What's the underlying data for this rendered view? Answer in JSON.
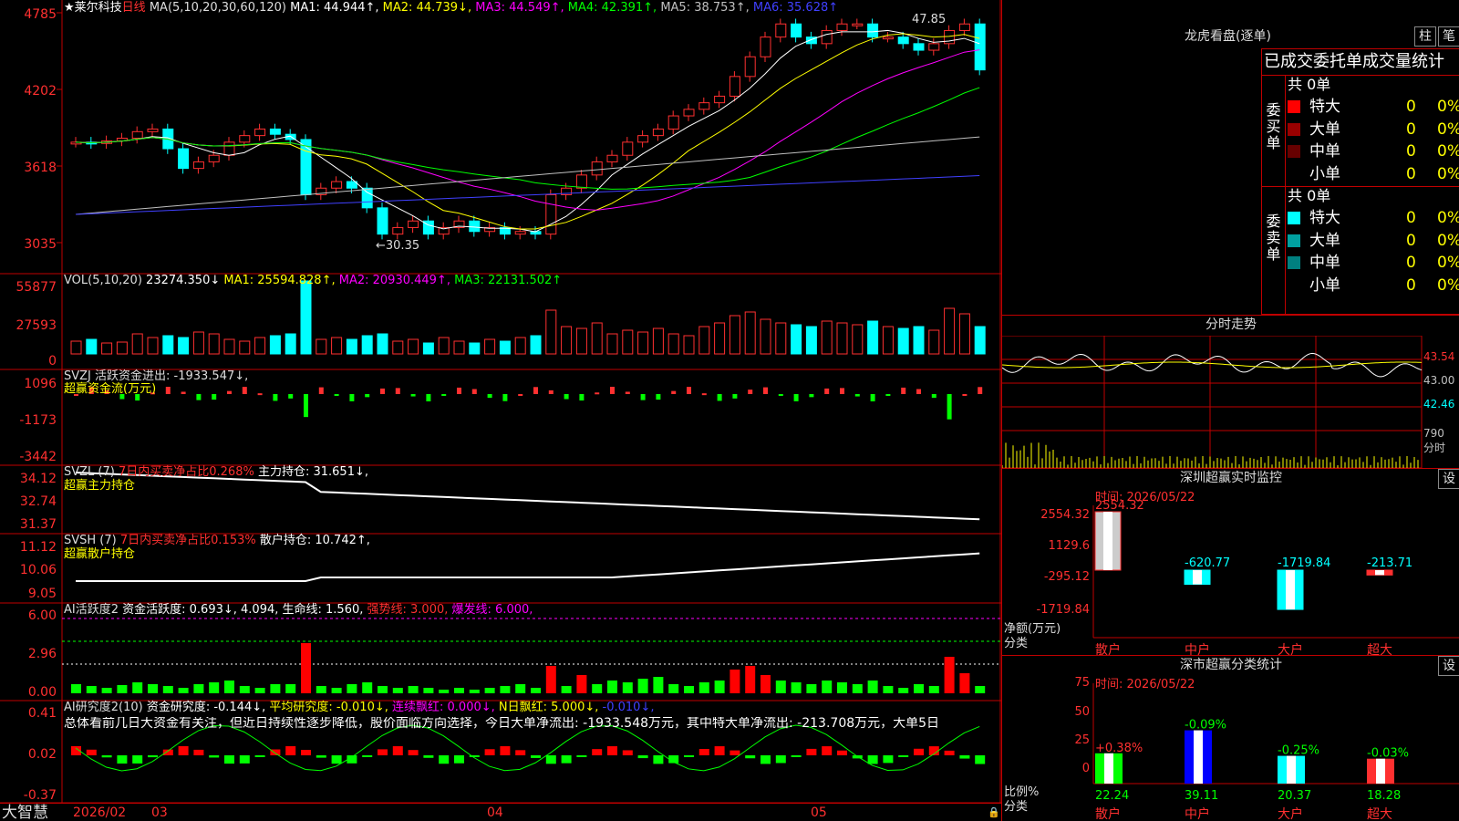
{
  "stock": {
    "star": "★",
    "name": "莱尔科技",
    "period": "日线"
  },
  "ma": {
    "label": "MA(5,10,20,30,60,120)",
    "items": [
      {
        "t": "MA1: 44.944↑",
        "c": "#ffffff"
      },
      {
        "t": "MA2: 44.739↓",
        "c": "#ffff00"
      },
      {
        "t": "MA3: 44.549↑",
        "c": "#ff00ff"
      },
      {
        "t": "MA4: 42.391↑",
        "c": "#00ff00"
      },
      {
        "t": "MA5: 38.753↑",
        "c": "#c0c0c0"
      },
      {
        "t": "MA6: 35.628↑",
        "c": "#4040ff"
      }
    ]
  },
  "price_axis": [
    "4785",
    "4202",
    "3618",
    "3035"
  ],
  "hi_label": "47.85",
  "lo_label": "←30.35",
  "vol": {
    "label": "VOL(5,10,20)",
    "value": "23274.350↓",
    "items": [
      {
        "t": "MA1: 25594.828↑",
        "c": "#ffff00"
      },
      {
        "t": "MA2: 20930.449↑",
        "c": "#ff00ff"
      },
      {
        "t": "MA3: 22131.502↑",
        "c": "#00ff00"
      }
    ],
    "axis": [
      "55877",
      "27593",
      "0"
    ]
  },
  "svzj": {
    "label": "SVZJ  活跃资金进出: -1933.547↓,",
    "sub": "超赢资金流(万元)",
    "axis": [
      "1096",
      "-1173",
      "-3442"
    ]
  },
  "svzl": {
    "label": "SVZL (7)",
    "red": "7日内买卖净占比0.268%",
    "main": "主力持仓: 31.651↓,",
    "sub": "超赢主力持仓",
    "axis": [
      "34.12",
      "32.74",
      "31.37"
    ]
  },
  "svsh": {
    "label": "SVSH (7)",
    "red": "7日内买卖净占比0.153%",
    "main": "散户持仓: 10.742↑,",
    "sub": "超赢散户持仓",
    "axis": [
      "11.12",
      "10.06",
      "9.05"
    ]
  },
  "ai2": {
    "label": "AI活跃度2",
    "main": "资金活跃度: 0.693↓, 4.094, 生命线: 1.560,",
    "strong": "强势线: 3.000,",
    "burst": "爆发线: 6.000,",
    "axis": [
      "6.00",
      "2.96",
      "0.00"
    ]
  },
  "ai3": {
    "label": "AI研究度2(10)",
    "main": "资金研究度: -0.144↓,",
    "avg": "平均研究度: -0.010↓,",
    "c1": "连续飘红: 0.000↓,",
    "c2": "N日飘红: 5.000↓,",
    "c3": "-0.010↓,",
    "text": "总体看前几日大资金有关注，但近日持续性逐步降低，股价面临方向选择，今日大单净流出: -1933.548万元，其中特大单净流出: -213.708万元，大单5日",
    "axis": [
      "0.41",
      "0.02",
      "-0.37"
    ]
  },
  "bottom": {
    "logo": "大智慧",
    "year": "2026/02",
    "months": [
      "03",
      "04",
      "05"
    ]
  },
  "lhb": {
    "title": "龙虎看盘(逐单)",
    "btn1": "柱",
    "btn2": "笔",
    "header": "已成交委托单成交量统计",
    "buy": {
      "side": "委买单",
      "total": "共 0单",
      "rows": [
        {
          "name": "特大",
          "count": "0",
          "pct": "0%",
          "color": "#ff0000"
        },
        {
          "name": "大单",
          "count": "0",
          "pct": "0%",
          "color": "#990000"
        },
        {
          "name": "中单",
          "count": "0",
          "pct": "0%",
          "color": "#660000"
        },
        {
          "name": "小单",
          "count": "0",
          "pct": "0%",
          "color": "#000000"
        }
      ]
    },
    "sell": {
      "side": "委卖单",
      "total": "共 0单",
      "rows": [
        {
          "name": "特大",
          "count": "0",
          "pct": "0%",
          "color": "#00ffff"
        },
        {
          "name": "大单",
          "count": "0",
          "pct": "0%",
          "color": "#00a0a0"
        },
        {
          "name": "中单",
          "count": "0",
          "pct": "0%",
          "color": "#008080"
        },
        {
          "name": "小单",
          "count": "0",
          "pct": "0%",
          "color": "#000000"
        }
      ]
    }
  },
  "intraday": {
    "title": "分时走势",
    "prices": [
      "43.54",
      "43.00",
      "42.46"
    ],
    "vol": "790",
    "vol_lbl": "分时"
  },
  "monitor": {
    "title": "深圳超赢实时监控",
    "btn": "设",
    "time": "时间: 2026/05/22",
    "axis": [
      "2554.32",
      "1129.6",
      "-295.12",
      "-1719.84"
    ],
    "unit": "净额(万元)",
    "cat_lbl": "分类",
    "bars": [
      {
        "name": "散户",
        "val": "2554.32",
        "v": 2554.32
      },
      {
        "name": "中户",
        "val": "-620.77",
        "v": -620.77
      },
      {
        "name": "大户",
        "val": "-1719.84",
        "v": -1719.84
      },
      {
        "name": "超大",
        "val": "-213.71",
        "v": -213.71
      }
    ]
  },
  "category": {
    "title": "深市超赢分类统计",
    "btn": "设",
    "time": "时间: 2026/05/22",
    "axis": [
      "75",
      "50",
      "25",
      "0"
    ],
    "unit": "比例%",
    "cat_lbl": "分类",
    "bars": [
      {
        "name": "散户",
        "pct": "+0.38%",
        "val": "22.24",
        "v": 22.24
      },
      {
        "name": "中户",
        "pct": "-0.09%",
        "val": "39.11",
        "v": 39.11
      },
      {
        "name": "大户",
        "pct": "-0.25%",
        "val": "20.37",
        "v": 20.37
      },
      {
        "name": "超大",
        "pct": "-0.03%",
        "val": "18.28",
        "v": 18.28
      }
    ]
  }
}
